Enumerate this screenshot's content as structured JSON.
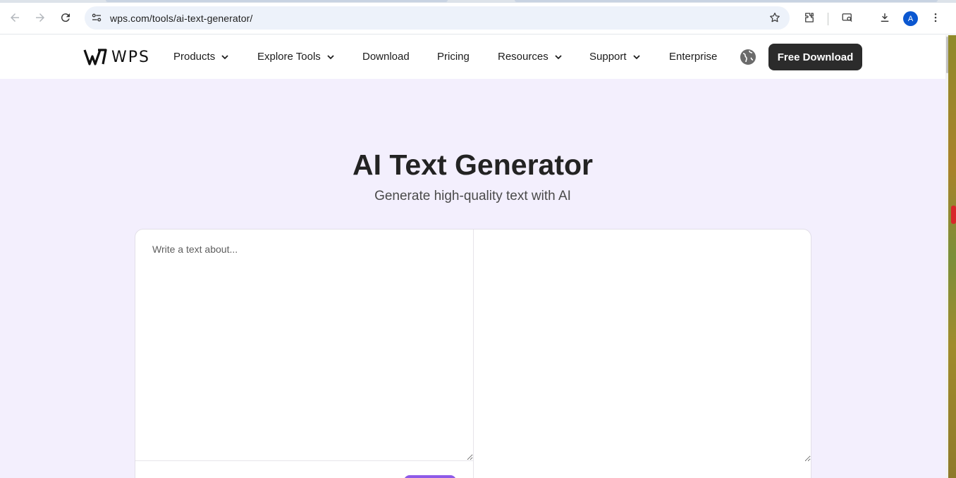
{
  "browser": {
    "url": "wps.com/tools/ai-text-generator/",
    "profile_initial": "A",
    "accent_color": "#0b57d0"
  },
  "header": {
    "logo_text": "WPS",
    "nav": [
      {
        "label": "Products",
        "has_dropdown": true
      },
      {
        "label": "Explore Tools",
        "has_dropdown": true
      },
      {
        "label": "Download",
        "has_dropdown": false
      },
      {
        "label": "Pricing",
        "has_dropdown": false
      },
      {
        "label": "Resources",
        "has_dropdown": true
      },
      {
        "label": "Support",
        "has_dropdown": true
      },
      {
        "label": "Enterprise",
        "has_dropdown": false
      }
    ],
    "cta_label": "Free Download",
    "cta_color": "#2b2b2b"
  },
  "hero": {
    "title": "AI Text Generator",
    "subtitle": "Generate high-quality text with AI"
  },
  "tool": {
    "input_placeholder": "Write a text about...",
    "input_value": "",
    "output_value": "",
    "generate_button_color": "#8e5ae8"
  },
  "page": {
    "background_color": "#f3effd"
  }
}
